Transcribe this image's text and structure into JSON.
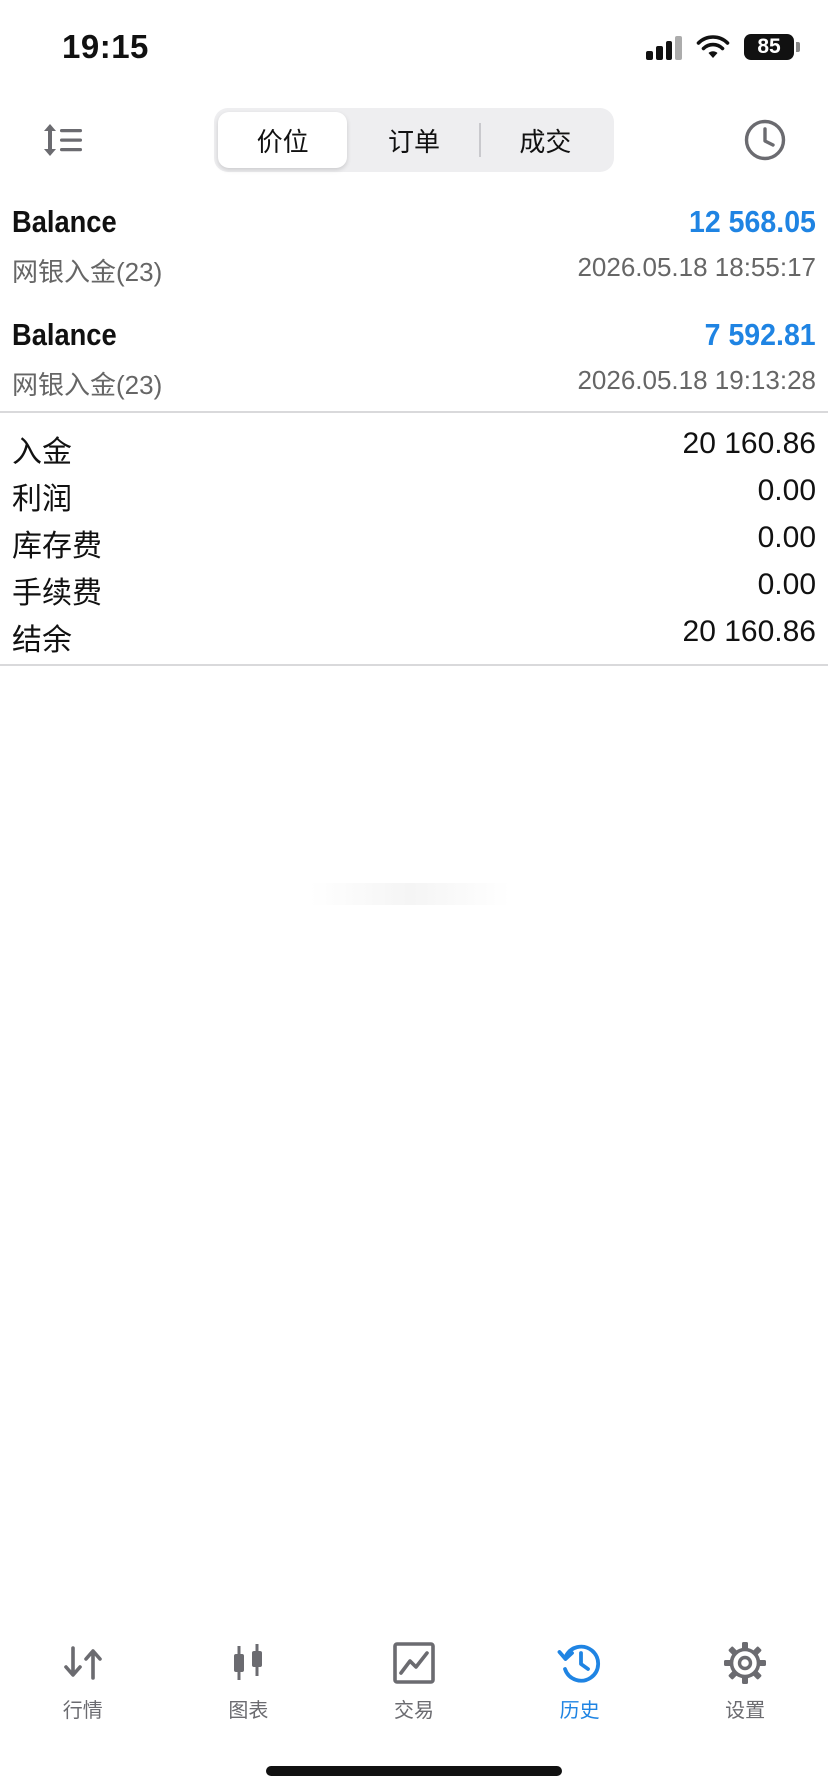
{
  "status_bar": {
    "time": "19:15",
    "battery": "85",
    "icons": [
      "signal-icon",
      "wifi-icon",
      "battery-icon"
    ]
  },
  "toolbar": {
    "sort_icon": "sort-icon",
    "clock_icon": "clock-icon",
    "segments": [
      {
        "label": "价位",
        "active": true
      },
      {
        "label": "订单",
        "active": false
      },
      {
        "label": "成交",
        "active": false
      }
    ]
  },
  "deals": [
    {
      "type": "Balance",
      "amount": "12 568.05",
      "comment": "网银入金(23)",
      "time": "2026.05.18 18:55:17"
    },
    {
      "type": "Balance",
      "amount": "7 592.81",
      "comment": "网银入金(23)",
      "time": "2026.05.18 19:13:28"
    }
  ],
  "summary": [
    {
      "label": "入金",
      "value": "20 160.86"
    },
    {
      "label": "利润",
      "value": "0.00"
    },
    {
      "label": "库存费",
      "value": "0.00"
    },
    {
      "label": "手续费",
      "value": "0.00"
    },
    {
      "label": "结余",
      "value": "20 160.86"
    }
  ],
  "tabbar": {
    "tabs": [
      {
        "label": "行情",
        "icon": "quotes-icon",
        "active": false
      },
      {
        "label": "图表",
        "icon": "chart-icon",
        "active": false
      },
      {
        "label": "交易",
        "icon": "trade-icon",
        "active": false
      },
      {
        "label": "历史",
        "icon": "history-icon",
        "active": true
      },
      {
        "label": "设置",
        "icon": "gear-icon",
        "active": false
      }
    ]
  },
  "colors": {
    "accent": "#1f84e3",
    "inactive_tab": "#6b6b70",
    "secondary_text": "#666666"
  }
}
